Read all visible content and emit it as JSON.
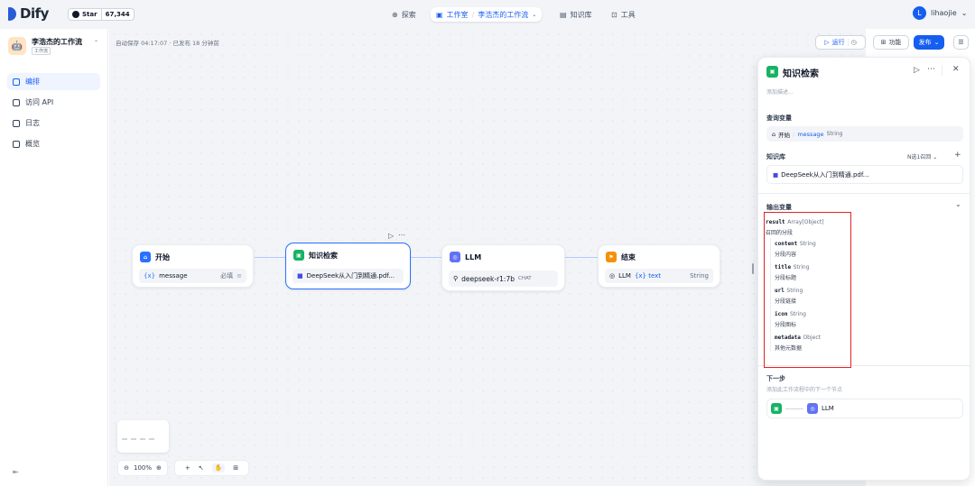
{
  "topbar": {
    "brand": "Dify",
    "github": {
      "star_label": "Star",
      "count": "67,344"
    },
    "nav": {
      "explore": "探索",
      "studio": "工作室",
      "app_crumb": "李浩杰的工作流",
      "knowledge": "知识库",
      "tools": "工具"
    },
    "user": {
      "initial": "L",
      "name": "lihaojie"
    }
  },
  "sidebar": {
    "app_name": "李浩杰的工作流",
    "app_tag": "工作流",
    "items": [
      {
        "label": "编排"
      },
      {
        "label": "访问 API"
      },
      {
        "label": "日志"
      },
      {
        "label": "概览"
      }
    ]
  },
  "toolbar": {
    "autosave": "自动保存 04:17:07 · 已发布 18 分钟前",
    "run": "运行",
    "features": "功能",
    "publish": "发布"
  },
  "nodes": {
    "start": {
      "title": "开始",
      "var_prefix": "{x}",
      "var": "message",
      "required": "必填"
    },
    "kr": {
      "title": "知识检索",
      "dataset": "DeepSeek从入门到精通.pdf..."
    },
    "llm": {
      "title": "LLM",
      "model": "deepseek-r1:7b",
      "mode": "CHAT"
    },
    "end": {
      "title": "结束",
      "src": "LLM",
      "var": "{x} text",
      "type": "String"
    }
  },
  "zoom": {
    "level": "100%"
  },
  "panel": {
    "title": "知识检索",
    "desc_placeholder": "添加描述...",
    "query_label": "查询变量",
    "query_src": "开始",
    "query_var": "message",
    "query_type": "String",
    "kb_label": "知识库",
    "kb_mode": "N选1召回",
    "kb_item": "DeepSeek从入门到精通.pdf...",
    "output_label": "输出变量",
    "result": {
      "name": "result",
      "type": "Array[Object]",
      "desc": "召回的分段"
    },
    "fields": [
      {
        "name": "content",
        "type": "String",
        "desc": "分段内容"
      },
      {
        "name": "title",
        "type": "String",
        "desc": "分段标题"
      },
      {
        "name": "url",
        "type": "String",
        "desc": "分段链接"
      },
      {
        "name": "icon",
        "type": "String",
        "desc": "分段图标"
      },
      {
        "name": "metadata",
        "type": "Object",
        "desc": "其他元数据"
      }
    ],
    "next_label": "下一步",
    "next_desc": "添加此工作流程中的下一个节点",
    "next_node": "LLM"
  },
  "colors": {
    "accent": "#155eef",
    "highlight": "#e02424"
  }
}
